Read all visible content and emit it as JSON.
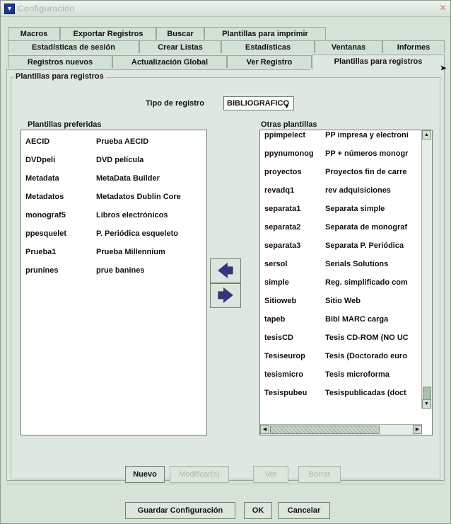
{
  "window": {
    "title": "Configuración"
  },
  "tabs": {
    "row1": [
      "Macros",
      "Exportar Registros",
      "Buscar",
      "Plantillas para imprimir"
    ],
    "row2": [
      "Estadísticas de sesión",
      "Crear Listas",
      "Estadísticas",
      "Ventanas",
      "Informes"
    ],
    "row3": [
      "Registros nuevos",
      "Actualización Global",
      "Ver Registro",
      "Plantillas para registros"
    ]
  },
  "group": {
    "label": "Plantillas para registros"
  },
  "tipo": {
    "label": "Tipo de registro",
    "value": "BIBLIOGRAFICO"
  },
  "preferred": {
    "label": "Plantillas preferidas",
    "rows": [
      [
        "AECID",
        "Prueba AECID"
      ],
      [
        "DVDpeli",
        "DVD película"
      ],
      [
        "Metadata",
        "MetaData Builder"
      ],
      [
        "Metadatos",
        "Metadatos Dublin Core"
      ],
      [
        "monograf5",
        "Libros electrónicos"
      ],
      [
        "ppesquelet",
        "P. Periódica esqueleto"
      ],
      [
        "Prueba1",
        "Prueba Millennium"
      ],
      [
        "prunines",
        "prue banines"
      ]
    ]
  },
  "other": {
    "label": "Otras plantillas",
    "rows": [
      [
        "ppimpelect",
        "PP impresa y electroni"
      ],
      [
        "ppynumonog",
        "PP + números monogr"
      ],
      [
        "proyectos",
        "Proyectos fin de carre"
      ],
      [
        "revadq1",
        "rev adquisiciones"
      ],
      [
        "separata1",
        "Separata simple"
      ],
      [
        "separata2",
        "Separata de monograf"
      ],
      [
        "separata3",
        "Separata P. Periódica"
      ],
      [
        "sersol",
        "Serials Solutions"
      ],
      [
        "simple",
        "Reg. simplificado com"
      ],
      [
        "Sitioweb",
        "Sitio Web"
      ],
      [
        "tapeb",
        "Bibl MARC carga"
      ],
      [
        "tesisCD",
        "Tesis CD-ROM (NO UC"
      ],
      [
        "Tesiseurop",
        "Tesis (Doctorado euro"
      ],
      [
        "tesismicro",
        "Tesis microforma"
      ],
      [
        "Tesispubeu",
        "Tesispublicadas (doct"
      ]
    ]
  },
  "buttons": {
    "nuevo": "Nuevo",
    "modificar": "Modificar(s)",
    "ver": "Ver",
    "borrar": "Borrar",
    "guardar": "Guardar Configuración",
    "ok": "OK",
    "cancelar": "Cancelar"
  }
}
